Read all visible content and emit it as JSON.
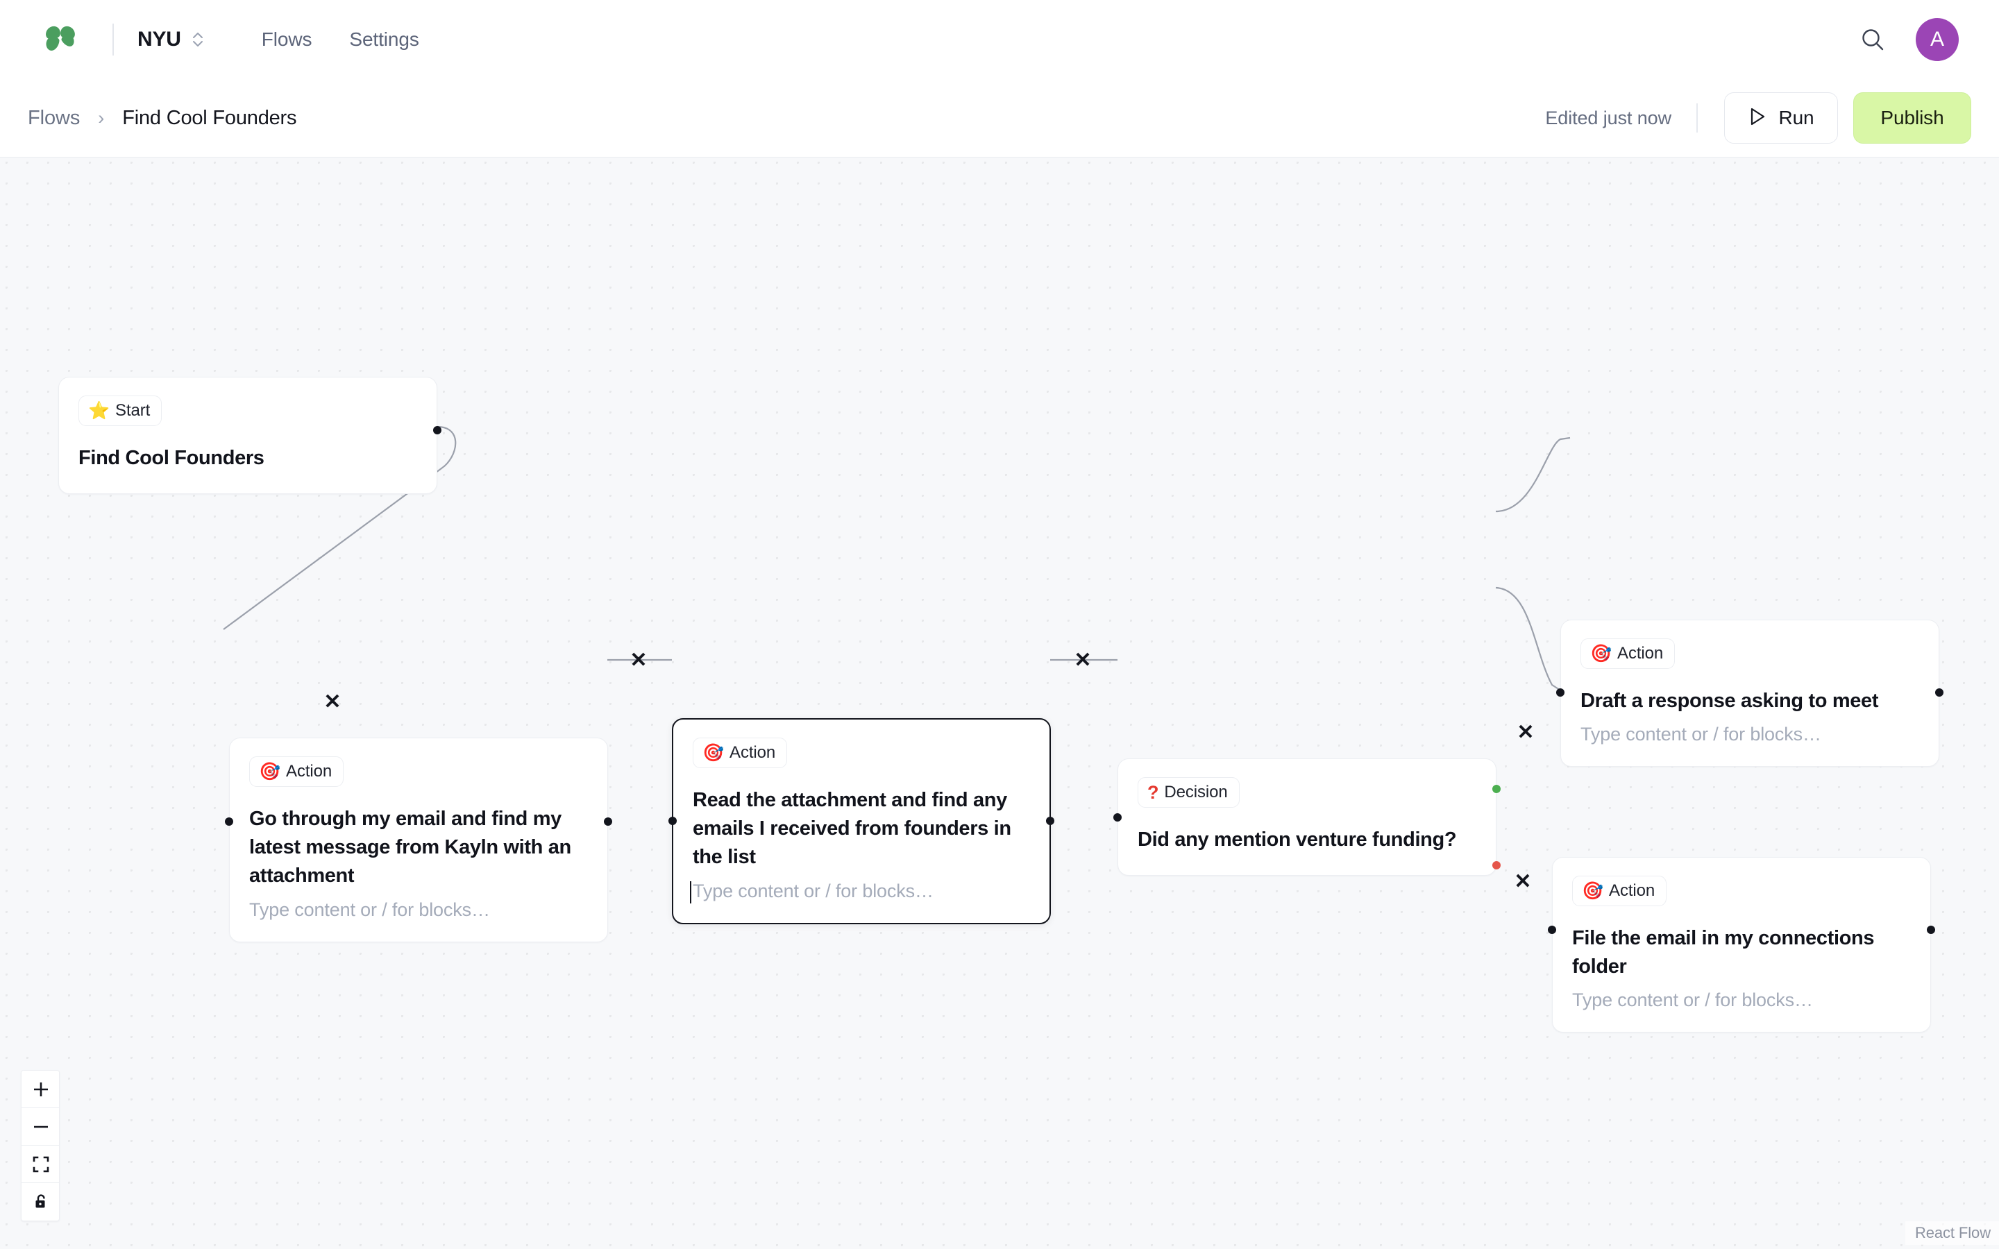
{
  "topnav": {
    "logo_name": "clover-logo",
    "org_name": "NYU",
    "links": [
      {
        "label": "Flows",
        "name": "nav-link-flows"
      },
      {
        "label": "Settings",
        "name": "nav-link-settings"
      }
    ],
    "search_icon": "search-icon",
    "avatar_initial": "A",
    "avatar_color": "#9b45b5"
  },
  "subheader": {
    "crumb_root": "Flows",
    "crumb_separator": "›",
    "crumb_current": "Find Cool Founders",
    "edited_status": "Edited just now",
    "run_label": "Run",
    "publish_label": "Publish",
    "publish_bg": "#d9f7a6"
  },
  "canvas": {
    "placeholder": "Type content or / for blocks…",
    "edge_delete_glyph": "✕",
    "attribution": "React Flow",
    "nodes": [
      {
        "id": "start",
        "badge_icon": "⭐",
        "badge_label": "Start",
        "title": "Find Cool Founders",
        "placeholder": "",
        "selected": false
      },
      {
        "id": "action-1",
        "badge_icon": "🎯",
        "badge_label": "Action",
        "title": "Go through my email and find my latest message from Kayln with an attachment",
        "placeholder": "Type content or / for blocks…",
        "selected": false
      },
      {
        "id": "action-2",
        "badge_icon": "🎯",
        "badge_label": "Action",
        "title": "Read the attachment and find any emails I received from founders in the list",
        "placeholder": "Type content or / for blocks…",
        "selected": true
      },
      {
        "id": "decision-1",
        "badge_icon": "?",
        "badge_label": "Decision",
        "title": "Did any mention venture funding?",
        "placeholder": "",
        "selected": false
      },
      {
        "id": "action-3",
        "badge_icon": "🎯",
        "badge_label": "Action",
        "title": "Draft a response asking to meet",
        "placeholder": "Type content or / for blocks…",
        "selected": false
      },
      {
        "id": "action-4",
        "badge_icon": "🎯",
        "badge_label": "Action",
        "title": "File the email in my connections folder",
        "placeholder": "Type content or / for blocks…",
        "selected": false
      }
    ]
  },
  "controls": {
    "zoom_in": "zoom-in-icon",
    "zoom_out": "zoom-out-icon",
    "fit_view": "fit-view-icon",
    "lock": "unlock-icon"
  }
}
